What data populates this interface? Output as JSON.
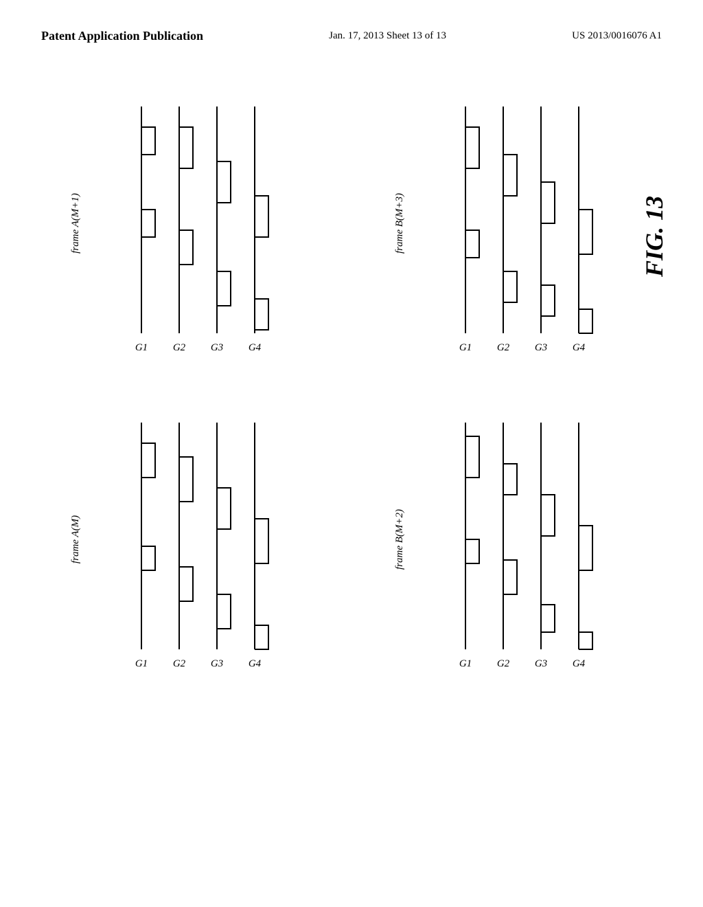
{
  "header": {
    "left_label": "Patent Application Publication",
    "center_label": "Jan. 17, 2013  Sheet 13 of 13",
    "right_label": "US 2013/0016076 A1"
  },
  "fig_label": "FIG. 13",
  "diagrams": {
    "top_left": {
      "frame_label": "frame A(M+1)",
      "columns": [
        "G1",
        "G2",
        "G3",
        "G4"
      ]
    },
    "top_right": {
      "frame_label": "frame B(M+3)",
      "columns": [
        "G1",
        "G2",
        "G3",
        "G4"
      ]
    },
    "bottom_left": {
      "frame_label": "frame A(M)",
      "columns": [
        "G1",
        "G2",
        "G3",
        "G4"
      ]
    },
    "bottom_right": {
      "frame_label": "frame B(M+2)",
      "columns": [
        "G1",
        "G2",
        "G3",
        "G4"
      ]
    }
  }
}
